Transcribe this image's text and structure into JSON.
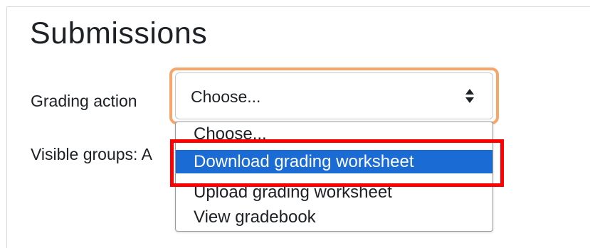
{
  "page": {
    "title": "Submissions"
  },
  "form": {
    "grading_action_label": "Grading action",
    "visible_groups_label": "Visible groups: A",
    "select": {
      "value": "Choose...",
      "options": [
        "Choose...",
        "Download grading worksheet",
        "Upload grading worksheet",
        "View gradebook"
      ],
      "highlighted_option": "Download grading worksheet"
    }
  },
  "colors": {
    "focus_ring": "#f7a66b",
    "selected_option_bg": "#1a6bd3",
    "annotation_box": "#ff0000"
  },
  "icons": {
    "select_caret": "sort-arrows-icon"
  }
}
